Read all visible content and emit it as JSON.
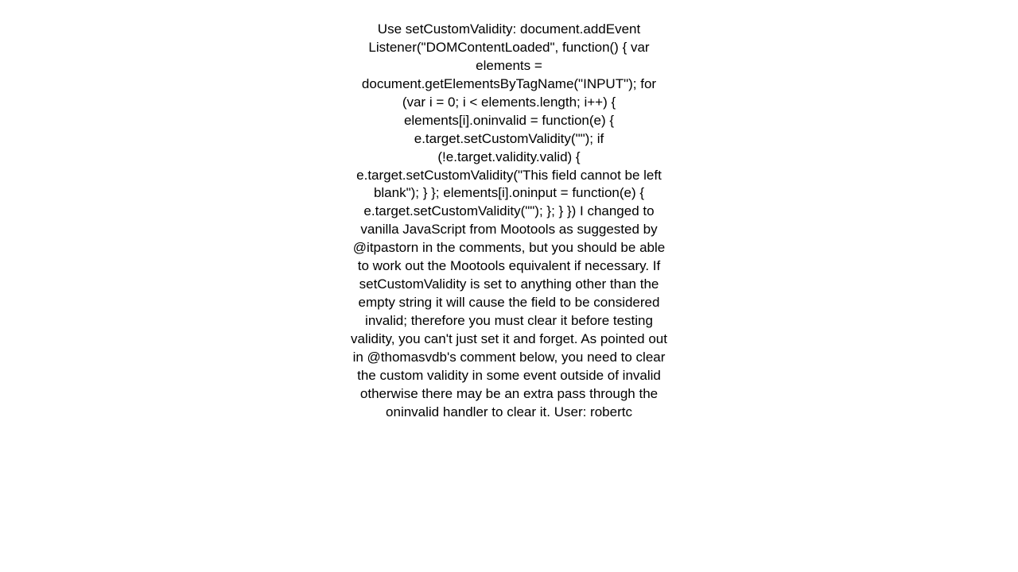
{
  "post": {
    "body": "Use setCustomValidity: document.addEvent Listener(\"DOMContentLoaded\", function() {     var elements = document.getElementsByTagName(\"INPUT\");     for (var i = 0; i < elements.length; i++) {         elements[i].oninvalid = function(e) {             e.target.setCustomValidity(\"\");             if (!e.target.validity.valid) {                 e.target.setCustomValidity(\"This field cannot be left blank\");             }         };         elements[i].oninput = function(e) {             e.target.setCustomValidity(\"\");         };     } })  I changed to vanilla JavaScript from Mootools as suggested by @itpastorn in the comments, but you should be able to work out the Mootools equivalent if necessary. If setCustomValidity is set to anything other than the empty string it will cause the field to be considered invalid; therefore you must clear it before testing validity, you can't just set it and forget. As pointed out in @thomasvdb's comment below, you need to clear the custom validity in some event outside of invalid otherwise there may be an extra pass through the oninvalid handler to clear it.  User: robertc"
  }
}
